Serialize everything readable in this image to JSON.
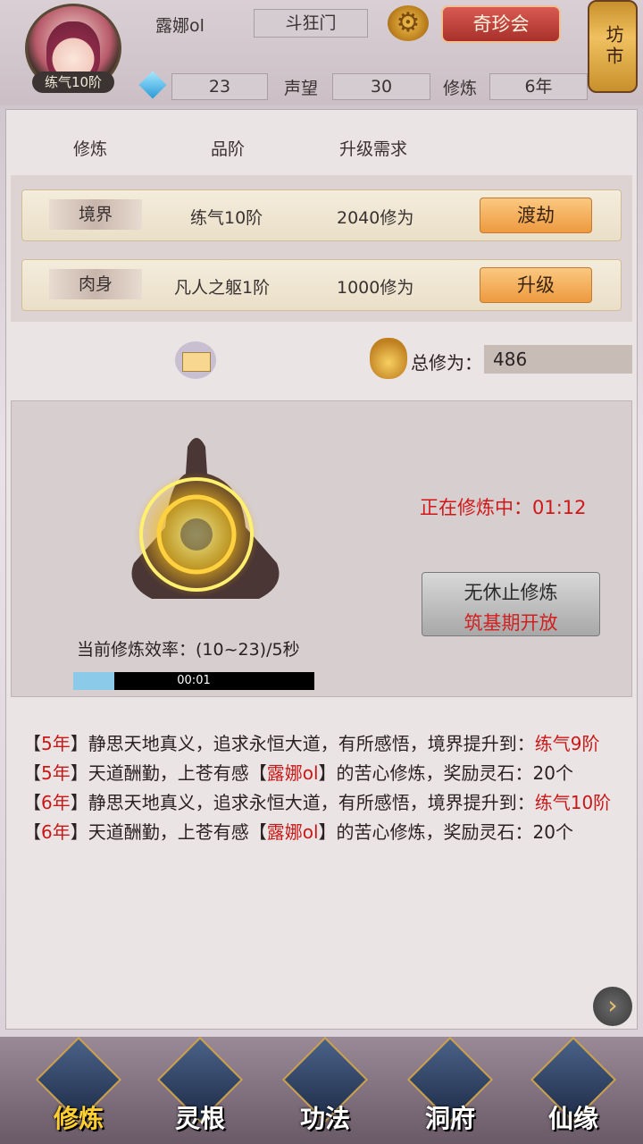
{
  "header": {
    "avatar_level": "练气10阶",
    "player_name": "露娜ol",
    "sect": "斗狂门",
    "settings_icon": "gear-icon",
    "event_button": "奇珍会",
    "market_button": "坊市",
    "spirit_stone_icon": "gem-icon",
    "spirit_stones": "23",
    "reputation_label": "声望",
    "reputation": "30",
    "cultivation_label": "修炼",
    "cultivation_years": "6年"
  },
  "table": {
    "headers": [
      "修炼",
      "品阶",
      "升级需求"
    ],
    "rows": [
      {
        "type": "境界",
        "grade": "练气10阶",
        "requirement": "2040修为",
        "action": "渡劫"
      },
      {
        "type": "肉身",
        "grade": "凡人之躯1阶",
        "requirement": "1000修为",
        "action": "升级"
      }
    ]
  },
  "summary": {
    "mail_icon": "envelope-icon",
    "bag_icon": "money-bag-icon",
    "total_label": "总修为：",
    "total_value": "486"
  },
  "cultivate": {
    "status": "正在修炼中：01:12",
    "endless_line1": "无休止修炼",
    "endless_line2": "筑基期开放",
    "rate": "当前修炼效率：(10~23)/5秒",
    "progress_text": "00:01",
    "progress_fraction": 0.17
  },
  "log": [
    {
      "year": "5年",
      "text": "静思天地真义，追求永恒大道，有所感悟，境界提升到：",
      "highlight": "练气9阶",
      "tail": ""
    },
    {
      "year": "5年",
      "text": "天道酬勤，上苍有感【",
      "highlight": "露娜ol",
      "tail": "】的苦心修炼，奖励灵石：20个"
    },
    {
      "year": "6年",
      "text": "静思天地真义，追求永恒大道，有所感悟，境界提升到：",
      "highlight": "练气10阶",
      "tail": ""
    },
    {
      "year": "6年",
      "text": "天道酬勤，上苍有感【",
      "highlight": "露娜ol",
      "tail": "】的苦心修炼，奖励灵石：20个"
    }
  ],
  "next_icon": "chevron-right-icon",
  "nav": [
    {
      "label": "修炼",
      "active": true
    },
    {
      "label": "灵根",
      "active": false
    },
    {
      "label": "功法",
      "active": false
    },
    {
      "label": "洞府",
      "active": false
    },
    {
      "label": "仙缘",
      "active": false
    }
  ],
  "colors": {
    "accent_red": "#d01818",
    "button_orange": "#ee9a40",
    "progress": "#8ccaea"
  }
}
